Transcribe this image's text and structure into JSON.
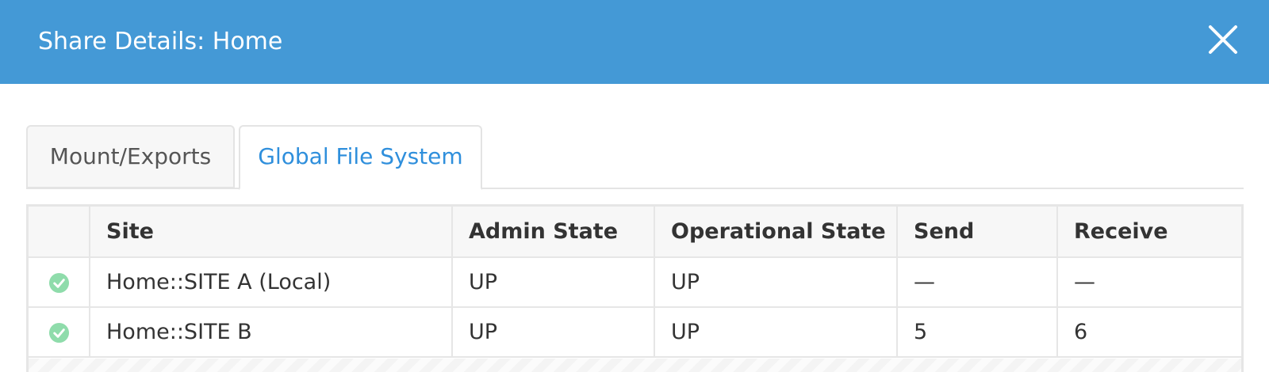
{
  "modal": {
    "title": "Share Details: Home",
    "close_icon": "close-icon",
    "header_color": "#4499d6"
  },
  "tabs": [
    {
      "label": "Mount/Exports",
      "active": false
    },
    {
      "label": "Global File System",
      "active": true
    }
  ],
  "table": {
    "columns": [
      "",
      "Site",
      "Admin State",
      "Operational State",
      "Send",
      "Receive"
    ],
    "rows": [
      {
        "status_icon": "check-circle-icon",
        "site": "Home::SITE A (Local)",
        "admin_state": "UP",
        "operational_state": "UP",
        "send": "—",
        "receive": "—"
      },
      {
        "status_icon": "check-circle-icon",
        "site": "Home::SITE B",
        "admin_state": "UP",
        "operational_state": "UP",
        "send": "5",
        "receive": "6"
      }
    ]
  },
  "colors": {
    "accent": "#2f8fdc",
    "status_ok": "#8fdcab"
  }
}
